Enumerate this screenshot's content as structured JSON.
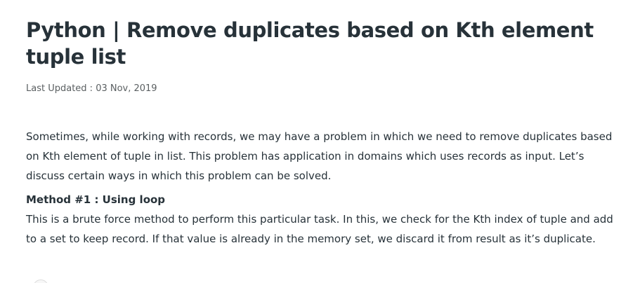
{
  "article": {
    "title": "Python | Remove duplicates based on Kth element tuple list",
    "last_updated": "Last Updated : 03 Nov, 2019",
    "intro": "Sometimes, while working with records, we may have a problem in which we need to remove duplicates based on Kth element of tuple in list. This problem has application in domains which uses records as input. Let’s discuss certain ways in which this problem can be solved.",
    "method1_heading": "Method #1 : Using loop",
    "method1_text": "This is a brute force method to perform this particular task. In this, we check for the Kth index of tuple and add to a set to keep record. If that value is already in the memory set, we discard it from result as it’s duplicate."
  }
}
